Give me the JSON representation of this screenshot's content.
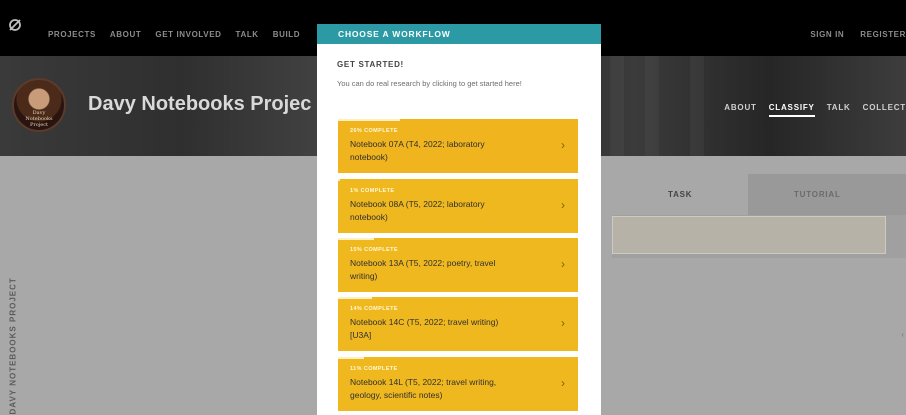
{
  "topnav": {
    "logo": "zooniverse-icon",
    "left_links": [
      "PROJECTS",
      "ABOUT",
      "GET INVOLVED",
      "TALK",
      "BUILD"
    ],
    "right_links": [
      "SIGN IN",
      "REGISTER"
    ]
  },
  "hero": {
    "avatar_text": "Davy\nNotebooks\nProject",
    "title": "Davy Notebooks Projec",
    "links": [
      "ABOUT",
      "CLASSIFY",
      "TALK",
      "COLLECT"
    ],
    "active_link": "CLASSIFY"
  },
  "side_label": "DAVY NOTEBOOKS PROJECT",
  "tabs": {
    "task": "TASK",
    "tutorial": "TUTORIAL"
  },
  "modal": {
    "title": "CHOOSE A WORKFLOW",
    "subtitle": "GET STARTED!",
    "intro": "You can do real research by clicking to get started here!",
    "workflows": [
      {
        "percent": "26% COMPLETE",
        "progress": 0.26,
        "name": "Notebook 07A (T4, 2022; laboratory notebook)"
      },
      {
        "percent": "1% COMPLETE",
        "progress": 0.01,
        "name": "Notebook 08A (T5, 2022; laboratory notebook)"
      },
      {
        "percent": "15% COMPLETE",
        "progress": 0.15,
        "name": "Notebook 13A (T5, 2022; poetry, travel writing)"
      },
      {
        "percent": "14% COMPLETE",
        "progress": 0.14,
        "name": "Notebook 14C (T5, 2022; travel writing) [U3A]"
      },
      {
        "percent": "11% COMPLETE",
        "progress": 0.11,
        "name": "Notebook 14L (T5, 2022; travel writing, geology, scientific notes)"
      }
    ]
  },
  "colors": {
    "accent": "#2B9AA4",
    "workflow": "#F0B81F",
    "nav": "#000000"
  }
}
